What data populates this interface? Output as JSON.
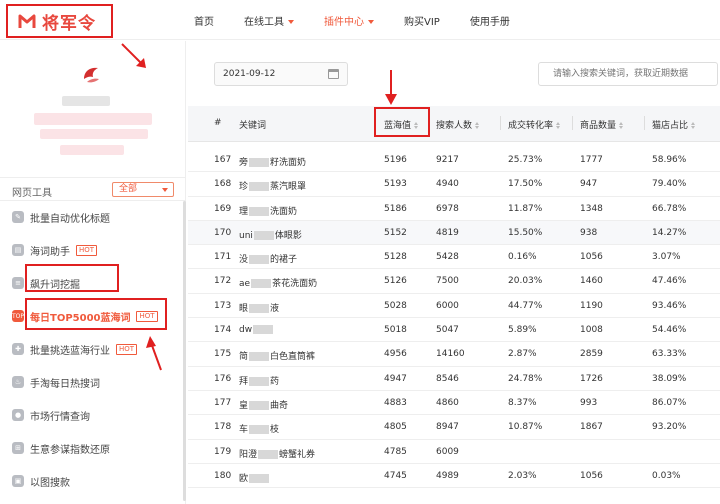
{
  "logo": {
    "text": "将军令",
    "accent": "#e8483e"
  },
  "nav": [
    {
      "label": "首页",
      "active": false,
      "caret": false
    },
    {
      "label": "在线工具",
      "active": false,
      "caret": true
    },
    {
      "label": "插件中心",
      "active": true,
      "caret": true
    },
    {
      "label": "购买VIP",
      "active": false,
      "caret": false
    },
    {
      "label": "使用手册",
      "active": false,
      "caret": false
    }
  ],
  "sidebar": {
    "tools_label": "网页工具",
    "filter_value": "全部",
    "items": [
      {
        "label": "批量自动优化标题",
        "hot": "",
        "icon": "edit-icon",
        "glyph": "✎"
      },
      {
        "label": "海词助手",
        "hot": "HOT",
        "icon": "book-icon",
        "glyph": "▤"
      },
      {
        "label": "飙升词挖掘",
        "hot": "",
        "icon": "doc-icon",
        "glyph": "≡"
      },
      {
        "label": "每日TOP5000蓝海词",
        "hot": "HOT",
        "icon": "top-icon",
        "glyph": "TOP"
      },
      {
        "label": "批量挑选蓝海行业",
        "hot": "HOT",
        "icon": "plus-icon",
        "glyph": "✚"
      },
      {
        "label": "手淘每日热搜词",
        "hot": "",
        "icon": "fire-icon",
        "glyph": "♨"
      },
      {
        "label": "市场行情查询",
        "hot": "",
        "icon": "chat-icon",
        "glyph": "●"
      },
      {
        "label": "生意参谋指数还原",
        "hot": "",
        "icon": "calc-icon",
        "glyph": "⊞"
      },
      {
        "label": "以图搜款",
        "hot": "",
        "icon": "image-icon",
        "glyph": "▣"
      }
    ]
  },
  "date": "2021-09-12",
  "search_placeholder": "请输入搜索关键词，获取近期数据",
  "table": {
    "headers": [
      "#",
      "关键词",
      "蓝海值",
      "搜索人数",
      "成交转化率",
      "商品数量",
      "猫店占比"
    ],
    "rows": [
      {
        "n": "167",
        "kw": [
          "旁",
          "籽洗面奶"
        ],
        "v": "5196",
        "s": "9217",
        "c": "25.73%",
        "g": "1777",
        "p": "58.96%"
      },
      {
        "n": "168",
        "kw": [
          "珍",
          "蒸汽眼罩"
        ],
        "v": "5193",
        "s": "4940",
        "c": "17.50%",
        "g": "947",
        "p": "79.40%"
      },
      {
        "n": "169",
        "kw": [
          "理",
          "洗面奶"
        ],
        "v": "5186",
        "s": "6978",
        "c": "11.87%",
        "g": "1348",
        "p": "66.78%"
      },
      {
        "n": "170",
        "kw": [
          "uni",
          "体眼影"
        ],
        "v": "5152",
        "s": "4819",
        "c": "15.50%",
        "g": "938",
        "p": "14.27%"
      },
      {
        "n": "171",
        "kw": [
          "没",
          "的裙子"
        ],
        "v": "5128",
        "s": "5428",
        "c": "0.16%",
        "g": "1056",
        "p": "3.07%"
      },
      {
        "n": "172",
        "kw": [
          "ae",
          "茶花洗面奶"
        ],
        "v": "5126",
        "s": "7500",
        "c": "20.03%",
        "g": "1460",
        "p": "47.46%"
      },
      {
        "n": "173",
        "kw": [
          "眼",
          "液"
        ],
        "v": "5028",
        "s": "6000",
        "c": "44.77%",
        "g": "1190",
        "p": "93.46%"
      },
      {
        "n": "174",
        "kw": [
          "dw",
          ""
        ],
        "v": "5018",
        "s": "5047",
        "c": "5.89%",
        "g": "1008",
        "p": "54.46%"
      },
      {
        "n": "175",
        "kw": [
          "简",
          "白色直筒裤"
        ],
        "v": "4956",
        "s": "14160",
        "c": "2.87%",
        "g": "2859",
        "p": "63.33%"
      },
      {
        "n": "176",
        "kw": [
          "拜",
          "药"
        ],
        "v": "4947",
        "s": "8546",
        "c": "24.78%",
        "g": "1726",
        "p": "38.09%"
      },
      {
        "n": "177",
        "kw": [
          "皇",
          "曲奇"
        ],
        "v": "4883",
        "s": "4860",
        "c": "8.37%",
        "g": "993",
        "p": "86.07%"
      },
      {
        "n": "178",
        "kw": [
          "车",
          "枝"
        ],
        "v": "4805",
        "s": "8947",
        "c": "10.87%",
        "g": "1867",
        "p": "93.20%"
      },
      {
        "n": "179",
        "kw": [
          "阳澄",
          "螃蟹礼券"
        ],
        "v": "4785",
        "s": "6009",
        "c": "",
        "g": "",
        "p": ""
      },
      {
        "n": "180",
        "kw": [
          "欧",
          ""
        ],
        "v": "4745",
        "s": "4989",
        "c": "2.03%",
        "g": "1056",
        "p": "0.03%"
      }
    ]
  }
}
